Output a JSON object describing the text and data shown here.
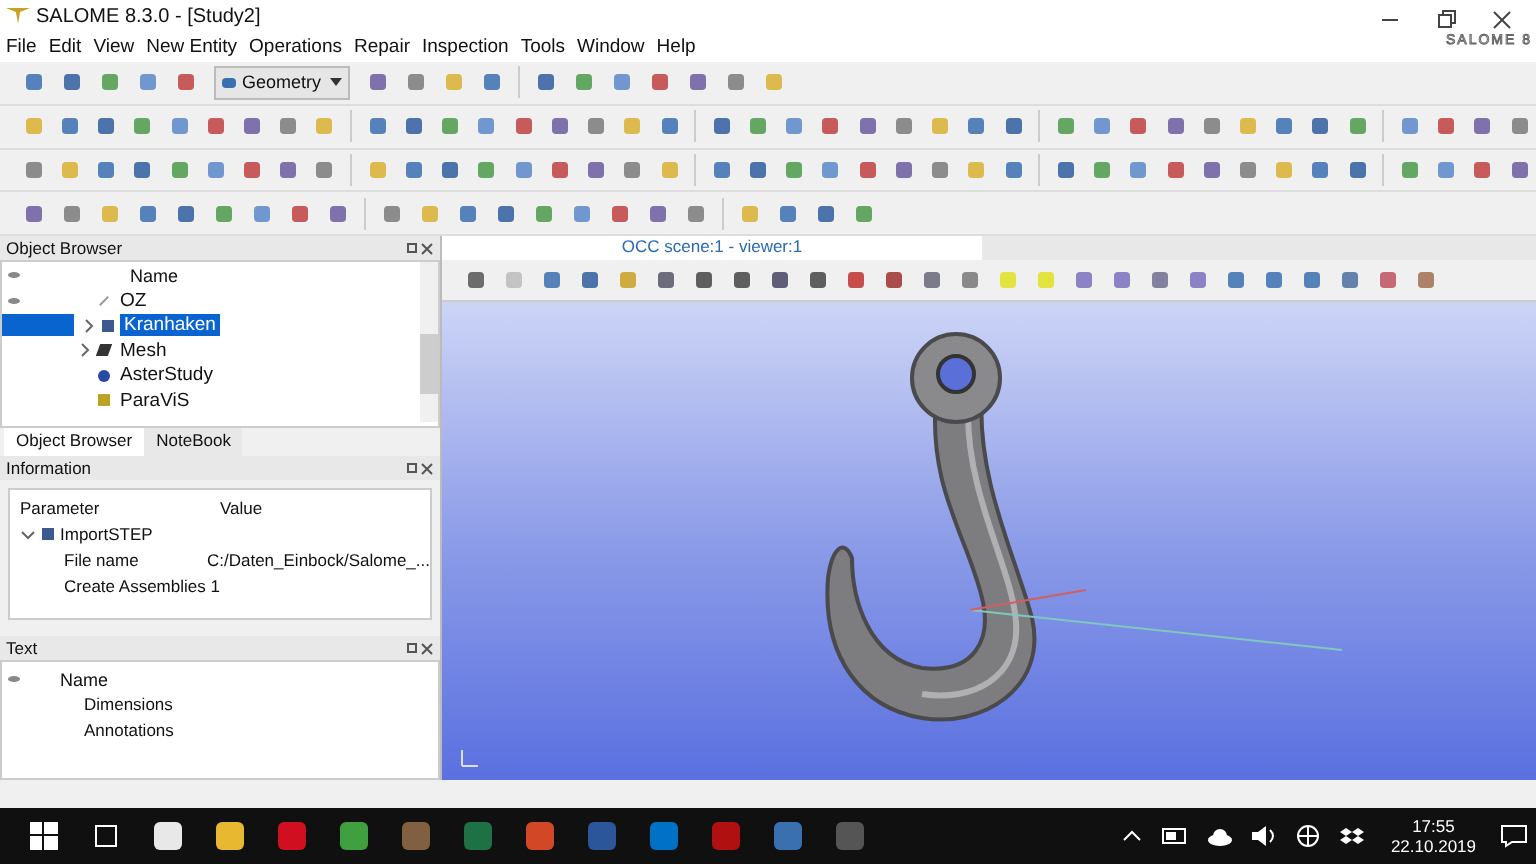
{
  "window": {
    "title": "SALOME 8.3.0 - [Study2]",
    "logo": "SALOME 8"
  },
  "menu": [
    "File",
    "Edit",
    "View",
    "New Entity",
    "Operations",
    "Repair",
    "Inspection",
    "Tools",
    "Window",
    "Help"
  ],
  "module_selector": {
    "value": "Geometry"
  },
  "object_browser": {
    "title": "Object Browser",
    "column": "Name",
    "continued": [
      {
        "label": "OZ",
        "kind": "line",
        "selected": false
      },
      {
        "label": "Kranhaken",
        "kind": "solid",
        "selected": true,
        "expanded": false
      }
    ],
    "items": [
      {
        "label": "Mesh",
        "kind": "mesh",
        "expanded": false
      },
      {
        "label": "AsterStudy",
        "kind": "aster"
      },
      {
        "label": "ParaViS",
        "kind": "paravis"
      }
    ],
    "tabs": [
      {
        "label": "Object Browser",
        "selected": true
      },
      {
        "label": "NoteBook",
        "selected": false
      }
    ]
  },
  "information": {
    "title": "Information",
    "columns": [
      "Parameter",
      "Value"
    ],
    "node": {
      "label": "ImportSTEP",
      "expanded": true,
      "rows": [
        {
          "parameter": "File name",
          "value": "C:/Daten_Einbock/Salome_..."
        },
        {
          "parameter": "Create Assemblies 1",
          "value": ""
        }
      ]
    }
  },
  "text_panel": {
    "title": "Text",
    "column": "Name",
    "items": [
      "Dimensions",
      "Annotations"
    ]
  },
  "viewer": {
    "title": "OCC scene:1 - viewer:1"
  },
  "taskbar": {
    "time": "17:55",
    "date": "22.10.2019"
  }
}
